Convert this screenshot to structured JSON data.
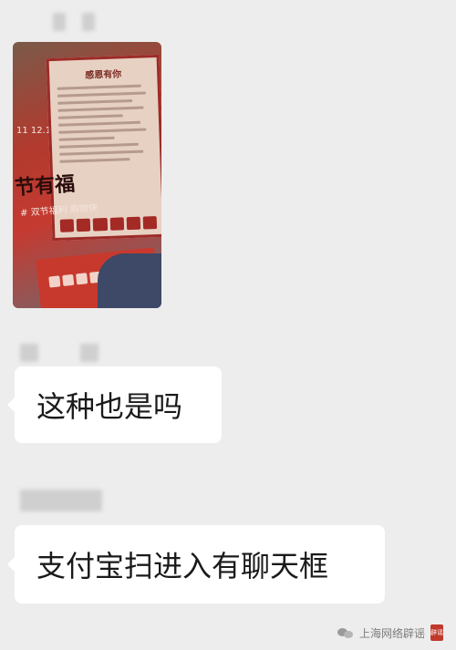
{
  "messages": [
    {
      "type": "image",
      "photo": {
        "card_title": "感恩有你",
        "date": "11 12.12",
        "headline": "节有福",
        "subtitle": "# 双节福利 购物快"
      }
    },
    {
      "type": "text",
      "text": "这种也是吗"
    },
    {
      "type": "text",
      "text": "支付宝扫进入有聊天框"
    }
  ],
  "footer": {
    "account": "上海网络辟谣",
    "seal": "辟谣"
  }
}
